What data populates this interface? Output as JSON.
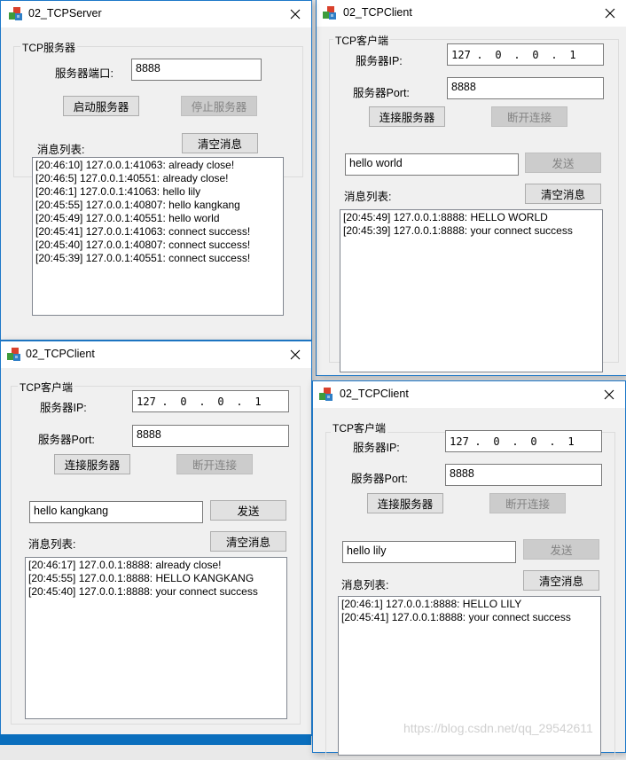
{
  "server": {
    "title": "02_TCPServer",
    "group_label": "TCP服务器",
    "port_label": "服务器端口:",
    "port_value": "8888",
    "start_button": "启动服务器",
    "stop_button": "停止服务器",
    "list_label": "消息列表:",
    "clear_button": "清空消息",
    "messages": [
      "[20:46:10] 127.0.0.1:41063: already close!",
      "[20:46:5] 127.0.0.1:40551: already close!",
      "[20:46:1] 127.0.0.1:41063: hello lily",
      "[20:45:55] 127.0.0.1:40807: hello kangkang",
      "[20:45:49] 127.0.0.1:40551: hello world",
      "[20:45:41] 127.0.0.1:41063: connect success!",
      "[20:45:40] 127.0.0.1:40807: connect success!",
      "[20:45:39] 127.0.0.1:40551: connect success!"
    ]
  },
  "clients": [
    {
      "title": "02_TCPClient",
      "group_label": "TCP客户端",
      "ip_label": "服务器IP:",
      "ip": [
        "127",
        "0",
        "0",
        "1"
      ],
      "ip_dot": ".",
      "port_label": "服务器Port:",
      "port_value": "8888",
      "connect_button": "连接服务器",
      "disconnect_button": "断开连接",
      "message_value": "hello world",
      "send_button": "发送",
      "send_enabled": false,
      "list_label": "消息列表:",
      "clear_button": "清空消息",
      "messages": [
        "[20:45:49] 127.0.0.1:8888: HELLO WORLD",
        "[20:45:39] 127.0.0.1:8888: your connect success"
      ]
    },
    {
      "title": "02_TCPClient",
      "group_label": "TCP客户端",
      "ip_label": "服务器IP:",
      "ip": [
        "127",
        "0",
        "0",
        "1"
      ],
      "ip_dot": ".",
      "port_label": "服务器Port:",
      "port_value": "8888",
      "connect_button": "连接服务器",
      "disconnect_button": "断开连接",
      "message_value": "hello kangkang",
      "send_button": "发送",
      "send_enabled": true,
      "list_label": "消息列表:",
      "clear_button": "清空消息",
      "messages": [
        "[20:46:17] 127.0.0.1:8888: already close!",
        "[20:45:55] 127.0.0.1:8888: HELLO KANGKANG",
        "[20:45:40] 127.0.0.1:8888: your connect success"
      ]
    },
    {
      "title": "02_TCPClient",
      "group_label": "TCP客户端",
      "ip_label": "服务器IP:",
      "ip": [
        "127",
        "0",
        "0",
        "1"
      ],
      "ip_dot": ".",
      "port_label": "服务器Port:",
      "port_value": "8888",
      "connect_button": "连接服务器",
      "disconnect_button": "断开连接",
      "message_value": "hello lily",
      "send_button": "发送",
      "send_enabled": false,
      "list_label": "消息列表:",
      "clear_button": "清空消息",
      "messages": [
        "[20:46:1] 127.0.0.1:8888: HELLO LILY",
        "[20:45:41] 127.0.0.1:8888: your connect success"
      ]
    }
  ],
  "watermark": "https://blog.csdn.net/qq_29542611",
  "colors": {
    "window_border": "#1e78c8",
    "window_bg": "#f0f0f0",
    "button_bg": "#e1e1e1",
    "button_disabled_bg": "#cccccc",
    "taskbar": "#0a6ebd"
  }
}
